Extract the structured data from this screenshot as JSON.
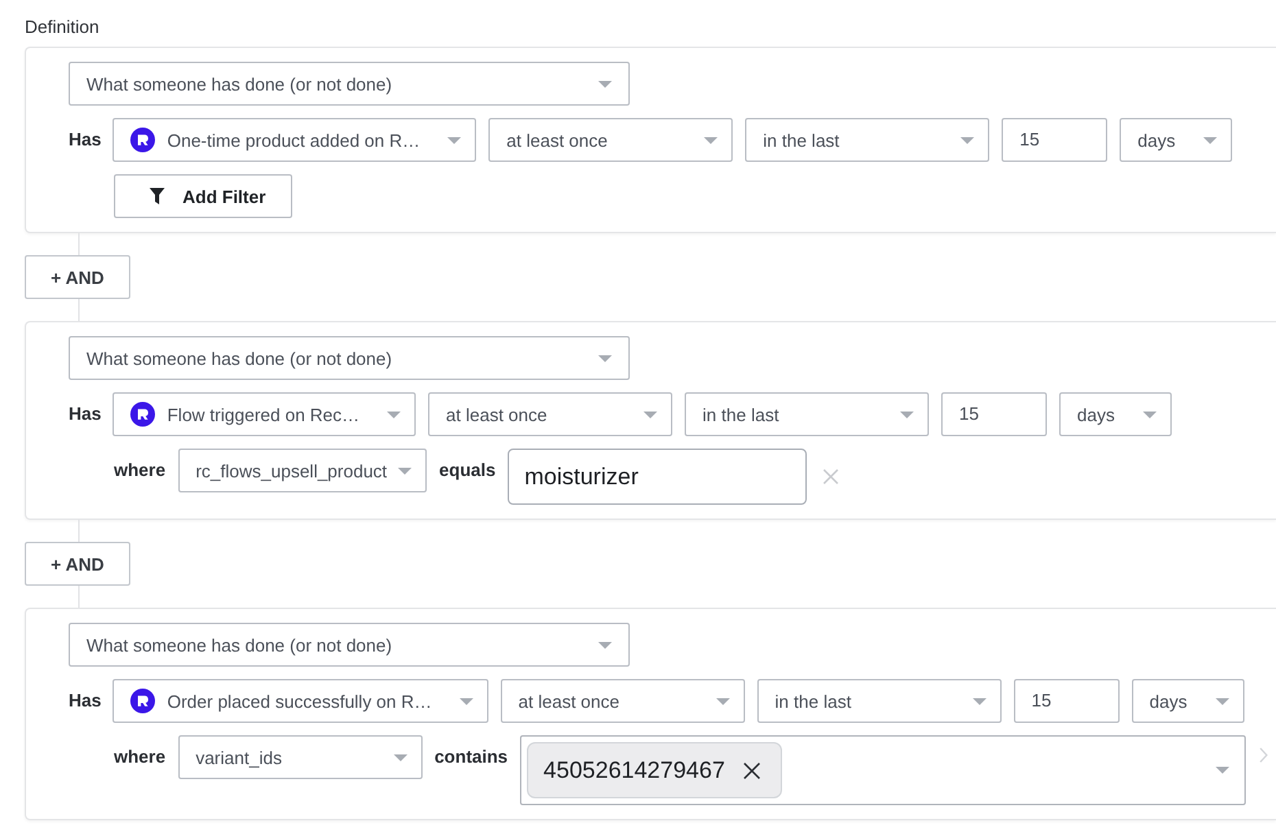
{
  "section": {
    "label": "Definition"
  },
  "items": [
    {
      "kind": "condition",
      "type_select": "What someone has done (or not done)",
      "has_label": "Has",
      "metric": "One-time product added on R…",
      "frequency": "at least once",
      "timeframe": "in the last",
      "amount": "15",
      "unit": "days",
      "filter": {
        "kind": "add",
        "button": "Add Filter"
      }
    },
    {
      "kind": "and",
      "label": "+ AND"
    },
    {
      "kind": "condition",
      "type_select": "What someone has done (or not done)",
      "has_label": "Has",
      "metric": "Flow triggered on Rec…",
      "frequency": "at least once",
      "timeframe": "in the last",
      "amount": "15",
      "unit": "days",
      "filter": {
        "kind": "equals",
        "where_label": "where",
        "property": "rc_flows_upsell_product",
        "operator": "equals",
        "value": "moisturizer"
      }
    },
    {
      "kind": "and",
      "label": "+ AND"
    },
    {
      "kind": "condition",
      "type_select": "What someone has done (or not done)",
      "has_label": "Has",
      "metric": "Order placed successfully on R…",
      "frequency": "at least once",
      "timeframe": "in the last",
      "amount": "15",
      "unit": "days",
      "filter": {
        "kind": "contains",
        "where_label": "where",
        "property": "variant_ids",
        "operator": "contains",
        "tags": [
          "45052614279467"
        ]
      }
    }
  ]
}
